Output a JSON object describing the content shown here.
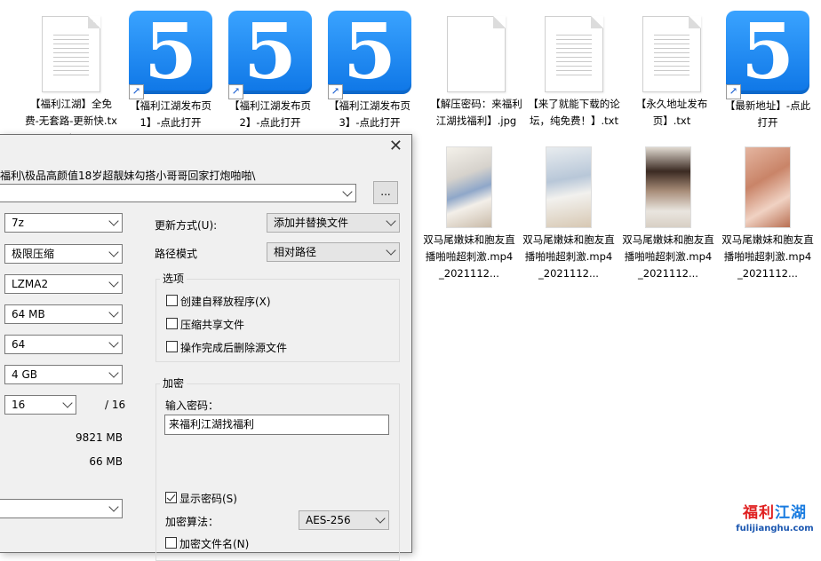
{
  "desktop": {
    "items": [
      {
        "type": "doc",
        "label": "【福利江湖】全免费-无套路-更新快.txt"
      },
      {
        "type": "tile",
        "glyph": "5",
        "label": "【福利江湖发布页1】-点此打开"
      },
      {
        "type": "tile",
        "glyph": "5",
        "label": "【福利江湖发布页2】-点此打开"
      },
      {
        "type": "tile",
        "glyph": "5",
        "label": "【福利江湖发布页3】-点此打开"
      },
      {
        "type": "doc",
        "label": "【解压密码：来福利江湖找福利】.jpg"
      },
      {
        "type": "doc",
        "label": "【来了就能下载的论坛，纯免费！】.txt"
      },
      {
        "type": "doc",
        "label": "【永久地址发布页】.txt"
      },
      {
        "type": "tile",
        "glyph": "5",
        "label": "【最新地址】-点此打开"
      },
      {
        "type": "photo",
        "label": "双马尾嫩妹和胞友直播啪啪超刺激.mp4_2021112..."
      },
      {
        "type": "photo",
        "label": "双马尾嫩妹和胞友直播啪啪超刺激.mp4_2021112..."
      },
      {
        "type": "photo",
        "label": "双马尾嫩妹和胞友直播啪啪超刺激.mp4_2021112..."
      },
      {
        "type": "photo",
        "label": "双马尾嫩妹和胞友直播啪啪超刺激.mp4_2021112..."
      }
    ]
  },
  "dialog": {
    "archive_path": "福利\\极品高颜值18岁超靓妹勾搭小哥哥回家打炮啪啪\\",
    "browse_label": "...",
    "format_value": "7z",
    "level_value": "极限压缩",
    "method_value": "LZMA2",
    "dictionary_value": "64 MB",
    "word_size_value": "64",
    "solid_block_value": "4 GB",
    "threads_value": "16",
    "threads_max": "/ 16",
    "memory_compress": "9821 MB",
    "memory_decompress": "66 MB",
    "split_value": "",
    "update_mode_label": "更新方式(U):",
    "update_mode_value": "添加并替换文件",
    "path_mode_label": "路径模式",
    "path_mode_value": "相对路径",
    "options_title": "选项",
    "opt_sfx": "创建自释放程序(X)",
    "opt_shared": "压缩共享文件",
    "opt_delete": "操作完成后删除源文件",
    "encryption_title": "加密",
    "password_label": "输入密码：",
    "password_value": "来福利江湖找福利",
    "show_password": "显示密码(S)",
    "enc_method_label": "加密算法：",
    "enc_method_value": "AES-256",
    "encrypt_names": "加密文件名(N)"
  },
  "watermark": {
    "cn_part1": "福利",
    "cn_part2": "江湖",
    "url": "fulijianghu.com"
  },
  "colors": {
    "tile_blue": "#1b8af0",
    "dialog_bg": "#f0f0f0",
    "watermark_red": "#e02020",
    "watermark_blue": "#1a7ce0"
  }
}
